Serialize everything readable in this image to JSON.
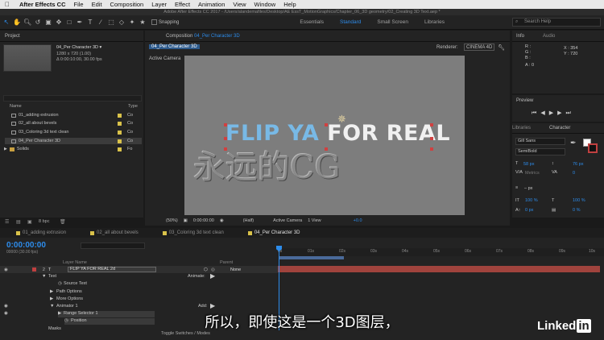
{
  "menubar": {
    "app": "After Effects CC",
    "items": [
      "File",
      "Edit",
      "Composition",
      "Layer",
      "Effect",
      "Animation",
      "View",
      "Window",
      "Help"
    ]
  },
  "titlebar": {
    "text": "Adobe After Effects CC 2017 - /Users/alandemafiles/Desktop/AE EssT_MotionGraphics/Chapter_06_3D geometry/02_Creating 3D Text.aep *"
  },
  "toolbar": {
    "snapping_label": "Snapping",
    "workspaces": [
      "Essentials",
      "Standard",
      "Small Screen",
      "Libraries"
    ],
    "active_workspace": "Standard",
    "search_placeholder": "Search Help"
  },
  "project": {
    "title": "Project",
    "selected_name": "04_Per Character 3D ▾",
    "selected_info1": "1280 x 720 (1.00)",
    "selected_info2": "Δ 0:00:10:00, 30.00 fps",
    "col_name": "Name",
    "col_type": "Type",
    "items": [
      {
        "name": "01_adding extrusion",
        "type": "Co",
        "label": "#d9c24a"
      },
      {
        "name": "02_all about bevels",
        "type": "Co",
        "label": "#d9c24a"
      },
      {
        "name": "03_Coloring 3d text clean",
        "type": "Co",
        "label": "#d9c24a"
      },
      {
        "name": "04_Per Character 3D",
        "type": "Co",
        "label": "#d9c24a"
      },
      {
        "name": "Solids",
        "type": "Fo",
        "label": "#d9c24a"
      }
    ],
    "bpc": "8 bpc"
  },
  "composition": {
    "tab_prefix": "Composition",
    "tab_name": "04_Per Character 3D",
    "subtab": "04_Per Character 3D",
    "renderer_label": "Renderer:",
    "renderer": "CINEMA 4D",
    "camera_label": "Active Camera",
    "text_part1": "FLIP YA ",
    "text_part2": "FOR REAL",
    "viewer_bar": [
      "(50%)",
      "0:00:00:00",
      "(Half)",
      "Active Camera",
      "1 View",
      "+0.0"
    ]
  },
  "info": {
    "title": "Info",
    "audio": "Audio",
    "r": "R :",
    "g": "G :",
    "b": "B :",
    "a": "A : 0",
    "x": "X : 354",
    "y": "Y : 720"
  },
  "preview": {
    "title": "Preview"
  },
  "character": {
    "libraries": "Libraries",
    "title": "Character",
    "font": "Gill Sans",
    "style": "SemiBold",
    "size": "58 px",
    "leading": "76 px",
    "kerning": "Metrics",
    "tracking": "0",
    "stroke": "– px",
    "vscale": "100 %",
    "hscale": "100 %",
    "baseline": "0 px",
    "tsume": "0 %"
  },
  "timeline": {
    "tabs": [
      {
        "name": "01_adding extrusion",
        "color": "#d9c24a"
      },
      {
        "name": "02_all about bevels",
        "color": "#d9c24a"
      },
      {
        "name": "03_Coloring 3d text clean",
        "color": "#d9c24a"
      },
      {
        "name": "04_Per Character 3D",
        "color": "#d9c24a"
      }
    ],
    "timecode": "0:00:00:00",
    "fps": "00000 (30.00 fps)",
    "col_layer": "Layer Name",
    "col_parent": "Parent",
    "layer_num": "2",
    "layer_name": "FLIP YA FOR REAL 2d",
    "parent_value": "None",
    "props": [
      "Text",
      "Source Text",
      "Path Options",
      "More Options",
      "Animator 1",
      "Range Selector 1",
      "Position",
      "Masks"
    ],
    "animate": "Animate:",
    "add": "Add:",
    "ruler": [
      "0s",
      "01s",
      "02s",
      "03s",
      "04s",
      "05s",
      "06s",
      "07s",
      "08s",
      "09s",
      "10s"
    ],
    "toggle": "Toggle Switches / Modes"
  },
  "subtitle": "所以，即使这是一个3D图层，",
  "watermark": "永远的CG",
  "brand": {
    "text": "Linked",
    "in": "in"
  }
}
